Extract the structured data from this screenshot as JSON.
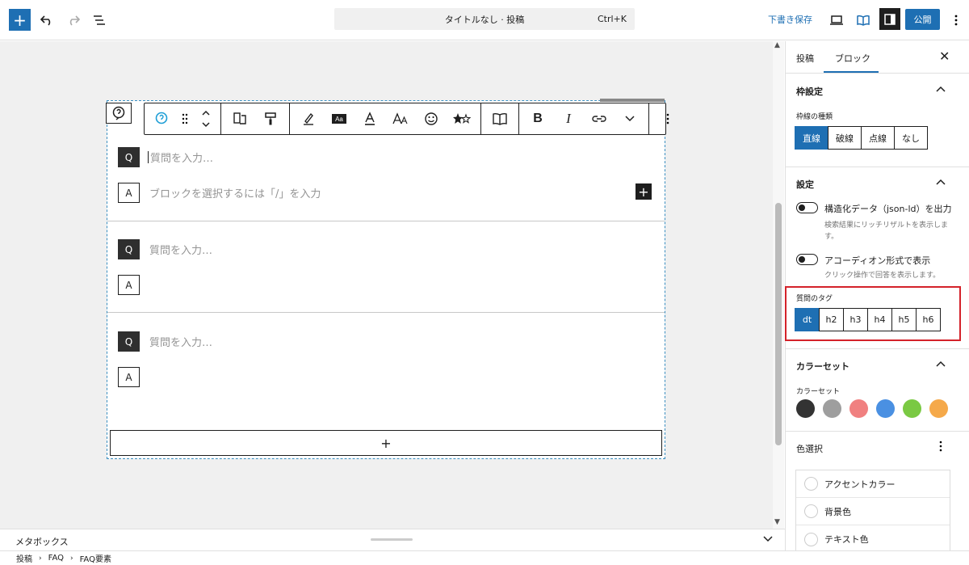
{
  "topbar": {
    "document_title": "タイトルなし · 投稿",
    "shortcut": "Ctrl+K",
    "save_draft": "下書き保存",
    "publish": "公開"
  },
  "editor": {
    "faq_items": [
      {
        "q_badge": "Q",
        "a_badge": "A",
        "question_placeholder": "質問を入力…",
        "answer_placeholder": "ブロックを選択するには「/」を入力"
      },
      {
        "q_badge": "Q",
        "a_badge": "A",
        "question_placeholder": "質問を入力…",
        "answer_placeholder": ""
      },
      {
        "q_badge": "Q",
        "a_badge": "A",
        "question_placeholder": "質問を入力…",
        "answer_placeholder": ""
      }
    ],
    "appender_label": "+"
  },
  "sidebar": {
    "tabs": [
      "投稿",
      "ブロック"
    ],
    "active_tab": "ブロック",
    "border_panel": {
      "title": "枠設定",
      "type_label": "枠線の種類",
      "options": [
        "直線",
        "破線",
        "点線",
        "なし"
      ],
      "selected": "直線"
    },
    "settings_panel": {
      "title": "設定",
      "toggle1_label": "構造化データ（json-ld）を出力",
      "toggle1_help": "検索結果にリッチリザルトを表示します。",
      "toggle2_label": "アコーディオン形式で表示",
      "toggle2_help": "クリック操作で回答を表示します。",
      "tag_label": "質問のタグ",
      "tag_options": [
        "dt",
        "h2",
        "h3",
        "h4",
        "h5",
        "h6"
      ],
      "tag_selected": "dt"
    },
    "colorset_panel": {
      "title": "カラーセット",
      "label": "カラーセット",
      "swatches": [
        "#333333",
        "#9e9e9e",
        "#f08080",
        "#4a90e2",
        "#7ac943",
        "#f5a94a"
      ]
    },
    "color_panel": {
      "title": "色選択",
      "items": [
        "アクセントカラー",
        "背景色",
        "テキスト色"
      ]
    }
  },
  "bottom": {
    "metabox": "メタボックス",
    "breadcrumb": [
      "投稿",
      "FAQ",
      "FAQ要素"
    ]
  },
  "colors": {
    "accent": "#1e6fb3",
    "highlight": "#d4222a"
  }
}
